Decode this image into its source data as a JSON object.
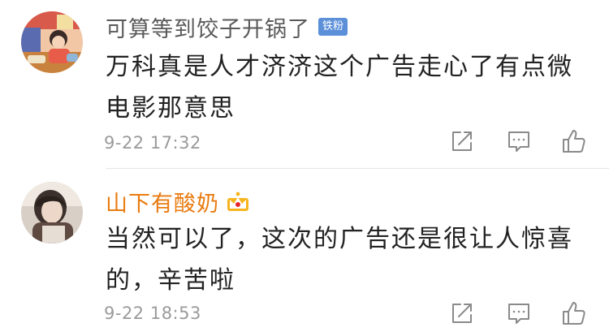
{
  "comments": [
    {
      "username": "可算等到饺子开锅了",
      "badge": "铁粉",
      "text": "万科真是人才济济这个广告走心了有点微电影那意思",
      "time": "9-22 17:32"
    },
    {
      "username": "山下有酸奶",
      "badge_icon": "crown-icon",
      "text": "当然可以了，这次的广告还是很让人惊喜的，辛苦啦",
      "time": "9-22 18:53"
    }
  ],
  "colors": {
    "username_default": "#5a5a5a",
    "username_vip": "#ea7b10",
    "fan_badge": "#5b8fd8",
    "text": "#222222",
    "meta": "#9a9a9a"
  },
  "icons": [
    "share-icon",
    "reply-icon",
    "like-icon"
  ]
}
